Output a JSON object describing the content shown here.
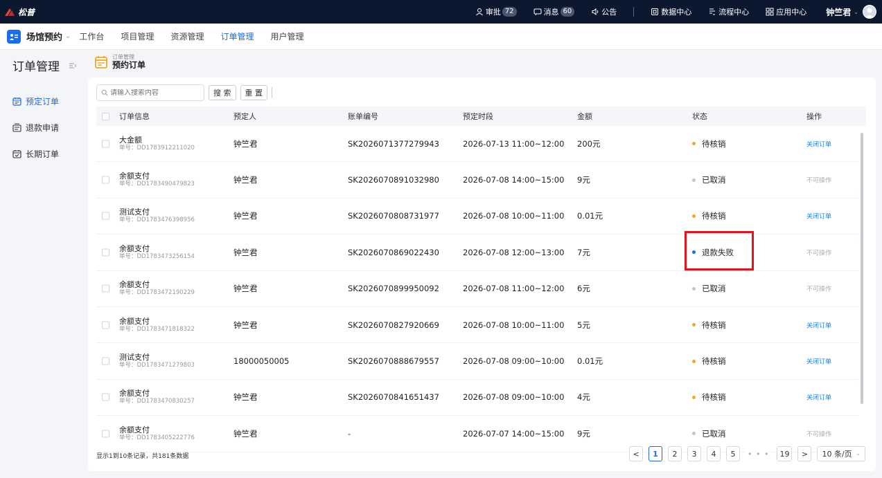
{
  "topbar": {
    "logo_text": "松普",
    "approve_label": "审批",
    "approve_count": "72",
    "message_label": "消息",
    "message_count": "60",
    "notice_label": "公告",
    "data_center": "数据中心",
    "flow_center": "流程中心",
    "app_center": "应用中心",
    "username": "钟竺君"
  },
  "nav": {
    "app_name": "场馆预约",
    "items": [
      "工作台",
      "项目管理",
      "资源管理",
      "订单管理",
      "用户管理"
    ],
    "active_index": 3
  },
  "sidebar": {
    "title": "订单管理",
    "items": [
      "预定订单",
      "退款申请",
      "长期订单"
    ],
    "active_index": 0
  },
  "page": {
    "breadcrumb_small": "订单管理",
    "title": "预约订单"
  },
  "search": {
    "placeholder": "请输入搜索内容",
    "search_btn": "搜 索",
    "reset_btn": "重 置"
  },
  "table": {
    "headers": [
      "订单信息",
      "预定人",
      "账单编号",
      "预定时段",
      "金额",
      "状态",
      "操作"
    ],
    "no_prefix": "单号：",
    "rows": [
      {
        "name": "大金额",
        "no": "DD1783912211020",
        "person": "钟竺君",
        "bill": "SK2026071377279943",
        "period": "2026-07-13 11:00~12:00",
        "amount": "200元",
        "status": "待核销",
        "status_color": "#f5a623",
        "op": "关闭订单",
        "op_enabled": true
      },
      {
        "name": "余额支付",
        "no": "DD1783490479823",
        "person": "钟竺君",
        "bill": "SK2026070891032980",
        "period": "2026-07-08 14:00~15:00",
        "amount": "9元",
        "status": "已取消",
        "status_color": "#c0c4cc",
        "op": "不可操作",
        "op_enabled": false
      },
      {
        "name": "测试支付",
        "no": "DD1783476398956",
        "person": "钟竺君",
        "bill": "SK2026070808731977",
        "period": "2026-07-08 10:00~11:00",
        "amount": "0.01元",
        "status": "待核销",
        "status_color": "#f5a623",
        "op": "关闭订单",
        "op_enabled": true
      },
      {
        "name": "余额支付",
        "no": "DD1783473256154",
        "person": "钟竺君",
        "bill": "SK2026070869022430",
        "period": "2026-07-08 12:00~13:00",
        "amount": "7元",
        "status": "退款失败",
        "status_color": "#1a6cf0",
        "op": "不可操作",
        "op_enabled": false
      },
      {
        "name": "余额支付",
        "no": "DD1783472190229",
        "person": "钟竺君",
        "bill": "SK2026070899950092",
        "period": "2026-07-08 11:00~12:00",
        "amount": "6元",
        "status": "已取消",
        "status_color": "#c0c4cc",
        "op": "不可操作",
        "op_enabled": false
      },
      {
        "name": "余额支付",
        "no": "DD1783471818322",
        "person": "钟竺君",
        "bill": "SK2026070827920669",
        "period": "2026-07-08 10:00~11:00",
        "amount": "5元",
        "status": "待核销",
        "status_color": "#f5a623",
        "op": "关闭订单",
        "op_enabled": true
      },
      {
        "name": "测试支付",
        "no": "DD1783471279803",
        "person": "18000050005",
        "bill": "SK2026070888679557",
        "period": "2026-07-08 09:00~10:00",
        "amount": "0.01元",
        "status": "待核销",
        "status_color": "#f5a623",
        "op": "关闭订单",
        "op_enabled": true
      },
      {
        "name": "余额支付",
        "no": "DD1783470830257",
        "person": "钟竺君",
        "bill": "SK2026070841651437",
        "period": "2026-07-08 09:00~10:00",
        "amount": "4元",
        "status": "待核销",
        "status_color": "#f5a623",
        "op": "关闭订单",
        "op_enabled": true
      },
      {
        "name": "余额支付",
        "no": "DD1783405222776",
        "person": "钟竺君",
        "bill": "-",
        "period": "2026-07-07 14:00~15:00",
        "amount": "9元",
        "status": "已取消",
        "status_color": "#c0c4cc",
        "op": "不可操作",
        "op_enabled": false
      }
    ]
  },
  "footer": {
    "summary": "显示1到10条记录，共181条数据",
    "pages": [
      "1",
      "2",
      "3",
      "4",
      "5"
    ],
    "ellipsis": "• • •",
    "last_page": "19",
    "page_size": "10 条/页",
    "active_page": "1"
  },
  "colors": {
    "accent": "#1a6cf0",
    "highlight": "#e0151b"
  }
}
